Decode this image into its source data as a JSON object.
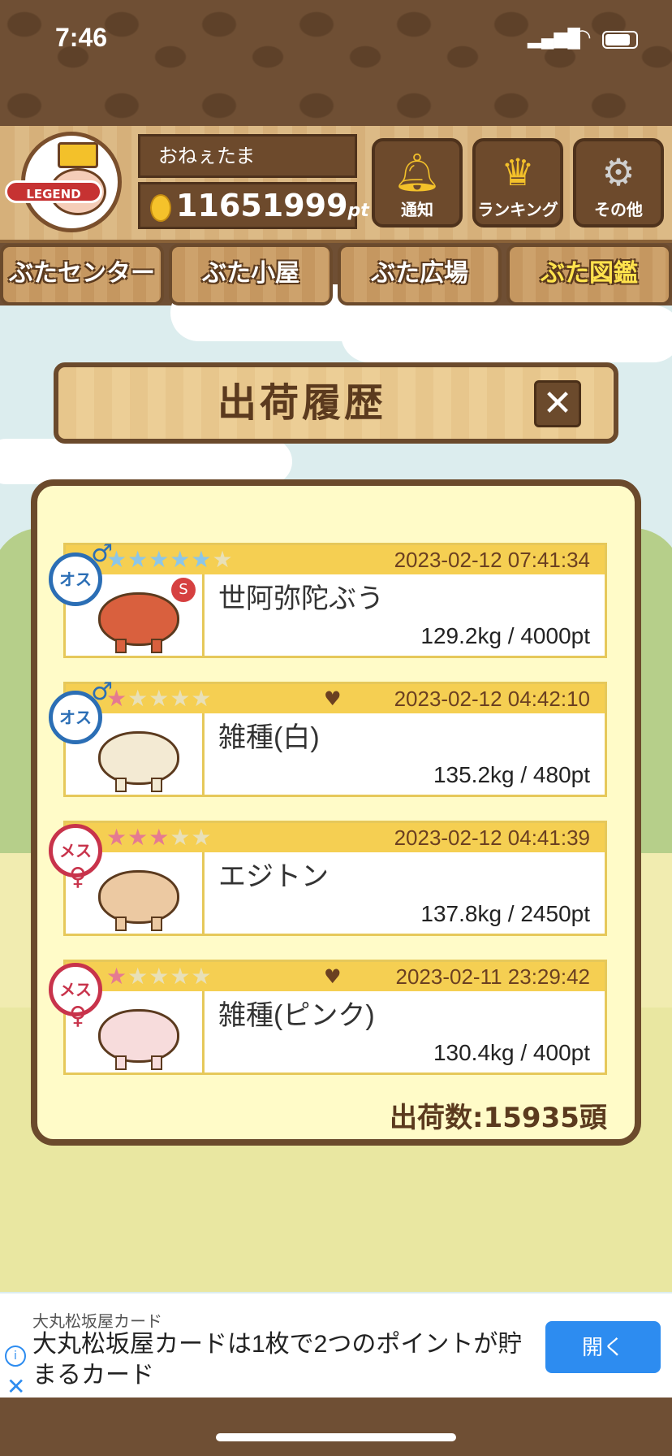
{
  "status_bar": {
    "time": "7:46"
  },
  "header": {
    "badge_text": "LEGEND",
    "player_name": "おねぇたま",
    "points_value": "11651999",
    "points_unit": "pt",
    "buttons": [
      {
        "label": "通知",
        "icon": "bell-icon"
      },
      {
        "label": "ランキング",
        "icon": "crown-icon"
      },
      {
        "label": "その他",
        "icon": "gear-icon"
      }
    ]
  },
  "tabs": [
    {
      "label": "ぶたセンター",
      "active": false
    },
    {
      "label": "ぶた小屋",
      "active": false
    },
    {
      "label": "ぶた広場",
      "active": false
    },
    {
      "label": "ぶた図鑑",
      "active": true
    }
  ],
  "dialog": {
    "title": "出荷履歴",
    "close_symbol": "✕",
    "entries": [
      {
        "gender": "オス",
        "stars_filled": 5,
        "stars_total": 6,
        "star_color": "#8cc6e8",
        "heart": false,
        "timestamp": "2023-02-12 07:41:34",
        "name": "世阿弥陀ぶう",
        "info": "129.2kg / 4000pt"
      },
      {
        "gender": "オス",
        "stars_filled": 1,
        "stars_total": 5,
        "star_color": "#e57a91",
        "heart": true,
        "timestamp": "2023-02-12 04:42:10",
        "name": "雑種(白)",
        "info": "135.2kg / 480pt"
      },
      {
        "gender": "メス",
        "stars_filled": 3,
        "stars_total": 5,
        "star_color": "#e57a91",
        "heart": false,
        "timestamp": "2023-02-12 04:41:39",
        "name": "エジトン",
        "info": "137.8kg / 2450pt"
      },
      {
        "gender": "メス",
        "stars_filled": 1,
        "stars_total": 5,
        "star_color": "#e57a91",
        "heart": true,
        "timestamp": "2023-02-11 23:29:42",
        "name": "雑種(ピンク)",
        "info": "130.4kg / 400pt"
      }
    ],
    "total_label": "出荷数:15935頭"
  },
  "ad": {
    "sponsor": "大丸松坂屋カード",
    "text": "大丸松坂屋カードは1枚で2つのポイントが貯まるカード",
    "button": "開く"
  }
}
